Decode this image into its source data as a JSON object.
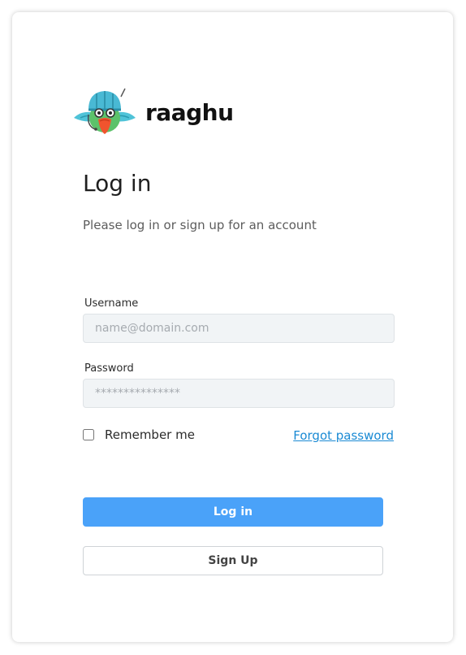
{
  "brand": {
    "name": "raaghu",
    "logo_icon": "parrot-mascot-icon"
  },
  "login": {
    "title": "Log in",
    "subtitle": "Please log in or sign up for an account",
    "username": {
      "label": "Username",
      "placeholder": "name@domain.com",
      "value": ""
    },
    "password": {
      "label": "Password",
      "placeholder": "***************",
      "value": ""
    },
    "remember_label": "Remember me",
    "remember_checked": false,
    "forgot_label": "Forgot password",
    "login_button": "Log in",
    "signup_button": "Sign Up"
  },
  "colors": {
    "primary": "#4aa2f9",
    "link": "#1a8ad4",
    "input_bg": "#f1f4f6"
  }
}
